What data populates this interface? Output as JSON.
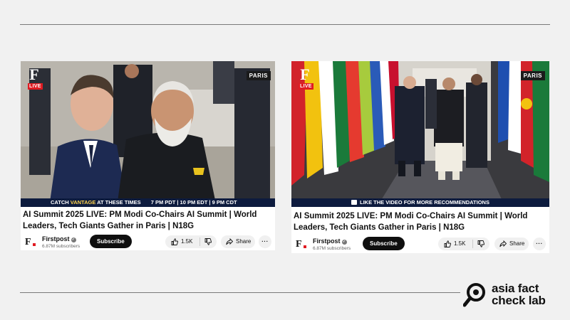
{
  "videos": [
    {
      "overlay": {
        "logo": "F",
        "live": "LIVE",
        "location": "PARIS",
        "ticker_prefix": "CATCH ",
        "ticker_highlight": "VANTAGE",
        "ticker_suffix": " AT THESE TIMES",
        "ticker_times": "7 PM PDT  |  10 PM EDT  |  9 PM CDT"
      },
      "title": "AI Summit 2025 LIVE: PM Modi Co-Chairs AI Summit | World Leaders, Tech Giants Gather in Paris | N18G",
      "channel": {
        "name": "Firstpost",
        "subscribers": "6.87M subscribers",
        "avatar": "F"
      },
      "subscribe_label": "Subscribe",
      "likes": "1.5K",
      "share_label": "Share",
      "more_label": "···"
    },
    {
      "overlay": {
        "logo": "F",
        "live": "LIVE",
        "location": "PARIS",
        "ticker": "LIKE THE VIDEO FOR MORE RECOMMENDATIONS"
      },
      "title": "AI Summit 2025 LIVE: PM Modi Co-Chairs AI Summit | World Leaders, Tech Giants Gather in Paris | N18G",
      "channel": {
        "name": "Firstpost",
        "subscribers": "6.87M subscribers",
        "avatar": "F"
      },
      "subscribe_label": "Subscribe",
      "likes": "1.5K",
      "share_label": "Share",
      "more_label": "···"
    }
  ],
  "brand": {
    "line1": "asia fact",
    "line2": "check lab",
    "icon": "magnifier-icon"
  },
  "colors": {
    "live_red": "#e01b22",
    "ticker_navy": "#0d1b3e",
    "ticker_highlight": "#ffd34d"
  }
}
